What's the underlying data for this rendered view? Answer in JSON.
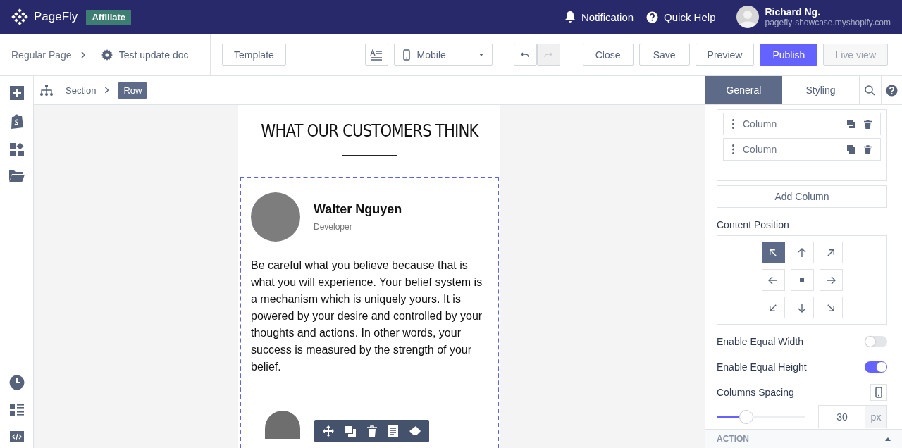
{
  "topbar": {
    "logo": "PageFly",
    "badge": "Affiliate",
    "notification": "Notification",
    "help": "Quick Help",
    "user": {
      "name": "Richard Ng.",
      "store": "pagefly-showcase.myshopify.com"
    }
  },
  "toolbar": {
    "page_type": "Regular Page",
    "page_name": "Test update doc",
    "template": "Template",
    "device": "Mobile",
    "actions": [
      {
        "label": "Close",
        "kind": "default",
        "disabled": false
      },
      {
        "label": "Save",
        "kind": "default",
        "disabled": false
      },
      {
        "label": "Preview",
        "kind": "default",
        "disabled": false
      },
      {
        "label": "Publish",
        "kind": "primary",
        "disabled": false
      },
      {
        "label": "Live view",
        "kind": "default",
        "disabled": true
      }
    ]
  },
  "breadcrumb": [
    {
      "label": "Section",
      "selected": false
    },
    {
      "label": "Row",
      "selected": true
    }
  ],
  "page": {
    "heading": "WHAT OUR CUSTOMERS THINK",
    "testimonial": {
      "name": "Walter Nguyen",
      "role": "Developer",
      "quote": "Be careful what you believe because that is what you will experience. Your belief system is a mechanism which is uniquely yours. It is powered by your desire and controlled by your thoughts and actions. In other words, your success is measured by the strength of your belief."
    }
  },
  "panel": {
    "tabs": [
      {
        "label": "General",
        "selected": true
      },
      {
        "label": "Styling",
        "selected": false
      }
    ],
    "columns": [
      "Column",
      "Column"
    ],
    "add_column": "Add Column",
    "content_position": {
      "label": "Content Position",
      "cells": [
        {
          "selected": true
        },
        {
          "selected": false
        },
        {
          "selected": false
        },
        {
          "selected": false
        },
        {
          "selected": false
        },
        {
          "selected": false
        },
        {
          "selected": false
        },
        {
          "selected": false
        },
        {
          "selected": false
        }
      ]
    },
    "toggles": [
      {
        "label": "Enable Equal Width",
        "on": false
      },
      {
        "label": "Enable Equal Height",
        "on": true
      }
    ],
    "spacing": {
      "label": "Columns Spacing",
      "level": 0.33,
      "value": "30",
      "unit": "px"
    },
    "section": "ACTION"
  }
}
